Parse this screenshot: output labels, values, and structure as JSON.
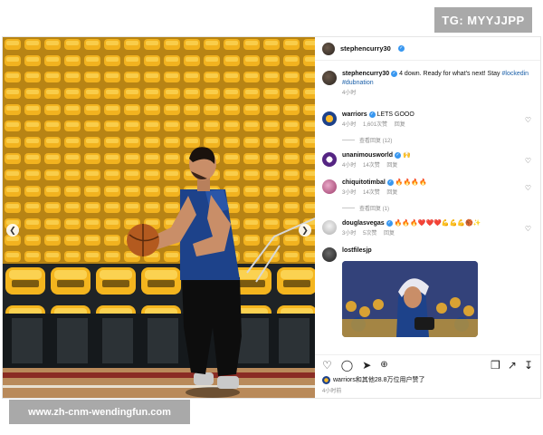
{
  "badge": {
    "text": "TG: MYYJJPP"
  },
  "watermark": {
    "text": "www.zh-cnm-wendingfun.com"
  },
  "header": {
    "username": "stephencurry30"
  },
  "caption": {
    "username": "stephencurry30",
    "text": "4 down. Ready for what's next! Stay",
    "tags": "#lockedin #dubnation",
    "time": "4小时"
  },
  "comments": [
    {
      "username": "warriors",
      "text": "LETS GOOO",
      "time": "4小时",
      "likes": "1,601次赞",
      "reply": "回复",
      "view_replies": "查看回复 (12)"
    },
    {
      "username": "unanimousworld",
      "text": "🙌",
      "time": "4小时",
      "likes": "14次赞",
      "reply": "回复"
    },
    {
      "username": "chiquitotimbal",
      "text": "🔥🔥🔥🔥",
      "time": "3小时",
      "likes": "14次赞",
      "reply": "回复",
      "view_replies": "查看回复 (1)"
    },
    {
      "username": "douglasvegas",
      "text": "🔥🔥🔥❤️❤️❤️💪💪💪🏀✨",
      "time": "3小时",
      "likes": "5次赞",
      "reply": "回复"
    },
    {
      "username": "lostfilesjp",
      "text": ""
    }
  ],
  "likes_line": {
    "text": "warriors和其他28.8万位用户赞了"
  },
  "footer_time": "4小时前",
  "icons": {
    "like": "heart-icon",
    "comment": "comment-icon",
    "share": "send-icon",
    "save": "bookmark-icon",
    "more": "more-icon"
  },
  "colors": {
    "verified": "#3897f0",
    "seat_yellow": "#f4b51e",
    "jersey_blue": "#1d428a"
  }
}
